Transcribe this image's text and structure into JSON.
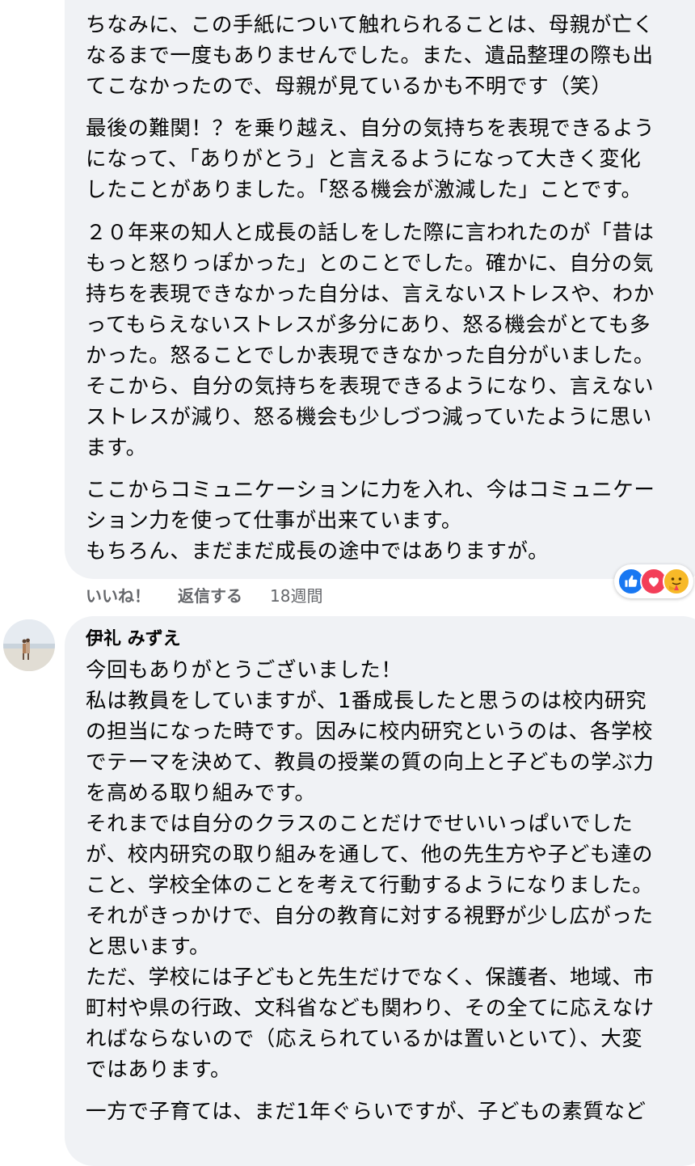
{
  "comment1": {
    "paragraphs": [
      "ちなみに、この手紙について触れられることは、母親が亡く\nなるまで一度もありませんでした。また、遺品整理の際も出\nてこなかったので、母親が見ているかも不明です（笑）",
      "最後の難関！？を乗り越え、自分の気持ちを表現できるよう\nになって、「ありがとう」と言えるようになって大きく変化\nしたことがありました。「怒る機会が激減した」ことです。",
      "２０年来の知人と成長の話しをした際に言われたのが「昔は\nもっと怒りっぽかった」とのことでした。確かに、自分の気\n持ちを表現できなかった自分は、言えないストレスや、わか\nってもらえないストレスが多分にあり、怒る機会がとても多\nかった。怒ることでしか表現できなかった自分がいました。\nそこから、自分の気持ちを表現できるようになり、言えない\nストレスが減り、怒る機会も少しづつ減っていたように思い\nます。",
      "ここからコミュニケーションに力を入れ、今はコミュニケー\nション力を使って仕事が出来ています。\nもちろん、まだまだ成長の途中ではありますが。"
    ],
    "like_label": "いいね！",
    "reply_label": "返信する",
    "timestamp": "18週間",
    "reactions": [
      "like-icon",
      "love-icon",
      "care-icon"
    ]
  },
  "comment2": {
    "author": "伊礼 みずえ",
    "paragraphs": [
      "今回もありがとうございました！\n私は教員をしていますが、1番成長したと思うのは校内研究\nの担当になった時です。因みに校内研究というのは、各学校\nでテーマを決めて、教員の授業の質の向上と子どもの学ぶ力\nを高める取り組みです。\nそれまでは自分のクラスのことだけでせいいっぱいでした\nが、校内研究の取り組みを通して、他の先生方や子ども達の\nこと、学校全体のことを考えて行動するようになりました。\nそれがきっかけで、自分の教育に対する視野が少し広がった\nと思います。\nただ、学校には子どもと先生だけでなく、保護者、地域、市\n町村や県の行政、文科省なども関わり、その全てに応えなけ\nればならないので（応えられているかは置いといて）、大変\nではあります。",
      "一方で子育ては、まだ1年ぐらいですが、子どもの素質など"
    ]
  },
  "colors": {
    "bubble": "#f0f2f5",
    "text": "#050505",
    "meta": "#65676b",
    "like": "#1877f2",
    "love": "#f33e58",
    "care": "#f7b928"
  }
}
